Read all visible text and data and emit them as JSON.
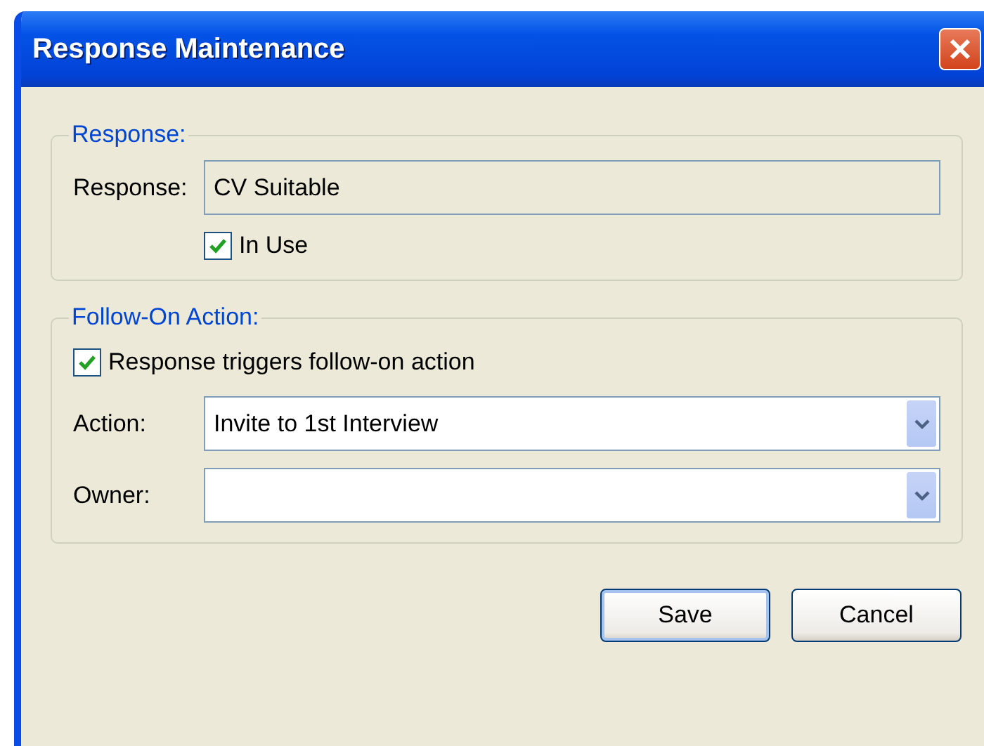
{
  "window": {
    "title": "Response Maintenance"
  },
  "response_group": {
    "title": "Response:",
    "label": "Response:",
    "value": "CV Suitable",
    "disabled": true,
    "in_use": {
      "label": "In Use",
      "checked": true
    }
  },
  "follow_on_group": {
    "title": "Follow-On Action:",
    "trigger": {
      "label": "Response triggers follow-on action",
      "checked": true
    },
    "fields": [
      {
        "label": "Action:",
        "value": "Invite to 1st Interview"
      },
      {
        "label": "Owner:"
      }
    ]
  },
  "buttons": [
    {
      "label": "Save",
      "default": true
    },
    {
      "label": "Cancel",
      "default": false
    }
  ]
}
